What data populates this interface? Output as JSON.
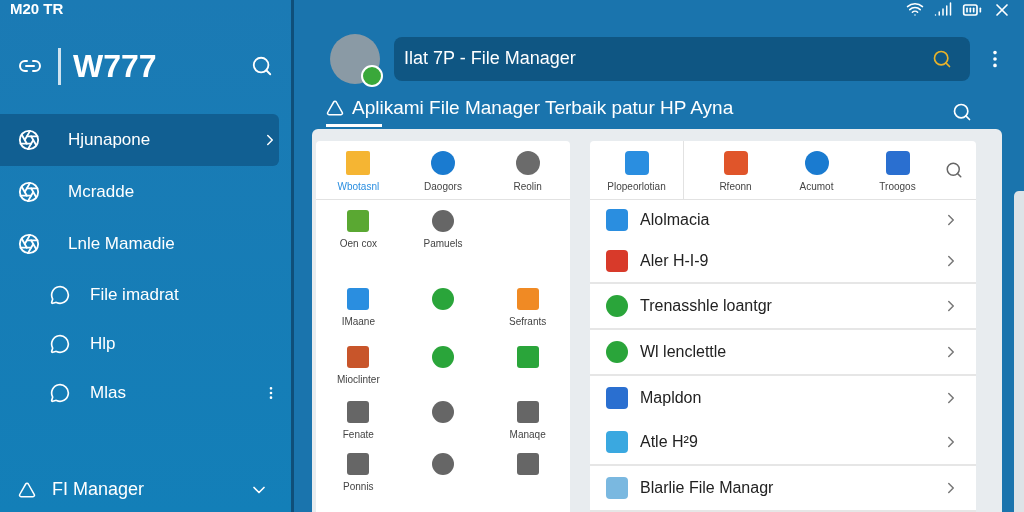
{
  "status_bar": {
    "time": "M20 TR"
  },
  "sidebar": {
    "title": "W777",
    "items": [
      {
        "label": "Hjunapone",
        "selected": true,
        "has_chevron": true
      },
      {
        "label": "Mcradde",
        "selected": false,
        "has_chevron": false
      },
      {
        "label": "Lnle Mamadie",
        "selected": false,
        "has_chevron": false,
        "children": [
          {
            "label": "File imadrat",
            "selected": false
          },
          {
            "label": "Hlp",
            "selected": false
          },
          {
            "label": "Mlas",
            "selected": false
          }
        ]
      }
    ],
    "footer": "FI Manager"
  },
  "header": {
    "search_value": "Ilat 7P - File Manager"
  },
  "tab": {
    "label": "Aplikami File Manager Terbaik patur HP Ayna",
    "selected": true
  },
  "left_grid": {
    "top": [
      {
        "label": "Wbotasnl",
        "selected": true,
        "color": "#f5b533"
      },
      {
        "label": "Daogors",
        "selected": false,
        "color": "#1a7bd0"
      },
      {
        "label": "Reolin",
        "selected": false,
        "color": "#6b6b6b"
      }
    ],
    "cells": [
      {
        "label": "Oen cox",
        "color": "#5aa832"
      },
      {
        "label": "Pamuels",
        "color": "#666666"
      },
      {},
      {
        "label": "IMaane",
        "color": "#2a8ee0"
      },
      {
        "color": "#2aa53a"
      },
      {
        "label": "Sefrants",
        "color": "#f08a24"
      },
      {
        "label": "Mioclinter",
        "color": "#c8552a"
      },
      {
        "color": "#2aa53a"
      },
      {
        "color": "#2aa53a"
      },
      {
        "label": "Fenate",
        "color": "#666666"
      },
      {
        "color": "#666666"
      },
      {
        "label": "Manaqe",
        "color": "#666666"
      },
      {
        "label": "Ponnis",
        "color": "#666666"
      },
      {
        "color": "#666666"
      },
      {
        "color": "#666666"
      }
    ]
  },
  "right_panel": {
    "tiles": [
      {
        "label": "Plopeorlotian",
        "color": "#2a8ee0"
      },
      {
        "label": "Rfeonn",
        "color": "#e0552a"
      },
      {
        "label": "Acumot",
        "color": "#1a7bd0"
      },
      {
        "label": "Troogos",
        "color": "#2a6fd0"
      }
    ],
    "rows": [
      {
        "label": "Alolmacia",
        "color": "#2a8ee0"
      },
      {
        "label": "Aler H-I-9",
        "color": "#d83a2a"
      },
      {
        "label": "Trenasshle loantgr",
        "color": "#2aa53a"
      },
      {
        "label": "Wl lenclettle",
        "color": "#2aa53a"
      },
      {
        "label": "Mapldon",
        "color": "#2a6fd0"
      },
      {
        "label": "Atle H²9",
        "color": "#3aa8e0"
      },
      {
        "label": "Blarlie File Managr",
        "color": "#7ab8e0"
      }
    ]
  }
}
